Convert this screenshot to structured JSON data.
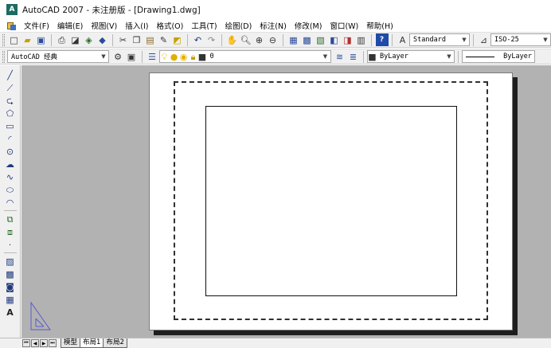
{
  "window": {
    "title": "AutoCAD 2007 - 未注册版 - [Drawing1.dwg]"
  },
  "menu": {
    "items": [
      "文件(F)",
      "编辑(E)",
      "视图(V)",
      "插入(I)",
      "格式(O)",
      "工具(T)",
      "绘图(D)",
      "标注(N)",
      "修改(M)",
      "窗口(W)",
      "帮助(H)"
    ]
  },
  "standard_toolbar": {
    "buttons": [
      "new-icon",
      "open-icon",
      "save-icon",
      "plot-icon",
      "plot-preview-icon",
      "publish-icon",
      "3d-dwf-icon",
      "cut-icon",
      "copy-icon",
      "paste-icon",
      "match-properties-icon",
      "block-editor-icon",
      "undo-icon",
      "redo-icon",
      "pan-icon",
      "zoom-realtime-icon",
      "zoom-window-icon",
      "zoom-previous-icon",
      "properties-icon",
      "design-center-icon",
      "tool-palettes-icon",
      "sheet-set-icon",
      "markup-icon",
      "quickcalc-icon",
      "help-icon"
    ],
    "text_style_value": "Standard",
    "dim_style_value": "ISO-25"
  },
  "layers_toolbar": {
    "workspace_value": "AutoCAD 经典",
    "layer_value": "0",
    "color_value": "ByLayer",
    "linetype_value": "ByLayer"
  },
  "draw_toolbar": {
    "tools": [
      "line-icon",
      "construction-line-icon",
      "polyline-icon",
      "polygon-icon",
      "rectangle-icon",
      "arc-icon",
      "circle-icon",
      "revision-cloud-icon",
      "spline-icon",
      "ellipse-icon",
      "ellipse-arc-icon",
      "insert-block-icon",
      "make-block-icon",
      "point-icon",
      "hatch-icon",
      "gradient-icon",
      "region-icon",
      "table-icon",
      "multiline-text-icon"
    ]
  },
  "tabs": {
    "model": "模型",
    "layout1": "布局1",
    "layout2": "布局2"
  },
  "colors": {
    "background": "#b2b2b2",
    "paper": "#ffffff",
    "toolbar": "#f0f0f0"
  }
}
